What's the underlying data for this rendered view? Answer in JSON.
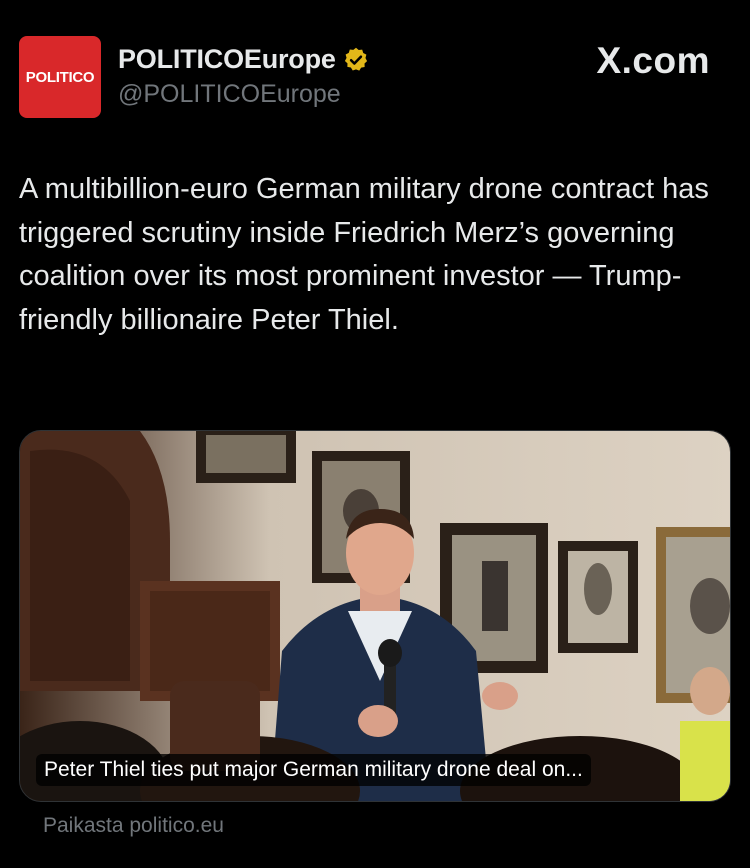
{
  "author": {
    "avatar_text": "POLITICO",
    "display_name": "POLITICOEurope",
    "handle": "@POLITICOEurope",
    "verified_icon": "verified-badge-icon",
    "avatar_color": "#d9282a",
    "badge_color": "#e2b719"
  },
  "brand": {
    "label": "X.com"
  },
  "tweet": {
    "text": "A multibillion-euro German military drone contract has triggered scrutiny inside Friedrich Merz’s governing coalition over its most prominent investor — Trump-friendly billionaire Peter Thiel."
  },
  "link_card": {
    "caption": "Peter Thiel ties put major German military drone deal on...",
    "image_icon": "photo-of-speaker-with-microphone",
    "source": "Paikasta politico.eu"
  }
}
